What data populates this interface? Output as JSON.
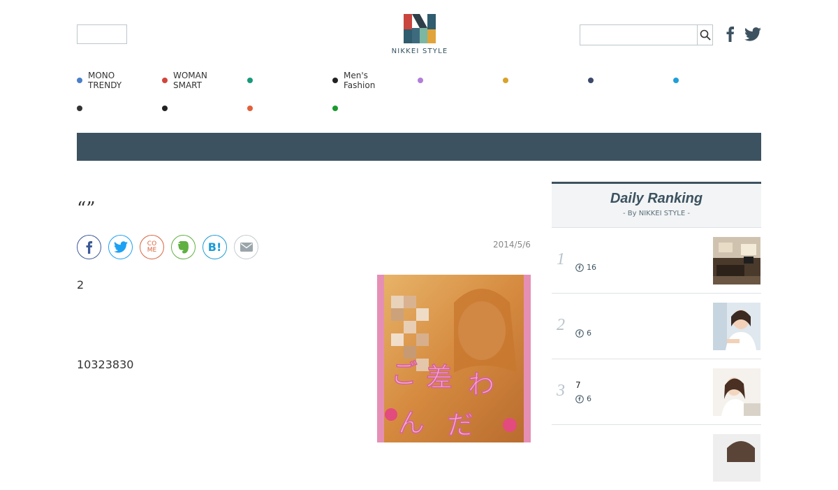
{
  "header": {
    "logo_text": "NIKKEI STYLE",
    "search_placeholder": ""
  },
  "nav": {
    "row1": [
      {
        "label": "MONO\nTRENDY",
        "color": "#4a7fc9"
      },
      {
        "label": "WOMAN\nSMART",
        "color": "#d2453c"
      },
      {
        "label": "",
        "color": "#1a9a7a"
      },
      {
        "label": "Men's\nFashion",
        "color": "#222222"
      },
      {
        "label": "",
        "color": "#b17ed9"
      },
      {
        "label": "",
        "color": "#d8a32a"
      },
      {
        "label": "",
        "color": "#3b4a6b"
      },
      {
        "label": "",
        "color": "#1f9fd9"
      }
    ],
    "row2": [
      {
        "label": "",
        "color": "#333333"
      },
      {
        "label": "",
        "color": "#222222"
      },
      {
        "label": "",
        "color": "#e2603a"
      },
      {
        "label": "",
        "color": "#1a9a2e"
      }
    ]
  },
  "article": {
    "title": "“”",
    "date": "2014/5/6",
    "para1": "2",
    "para2": "10323830",
    "share_come_label": "CO\nME",
    "share_hatena_label": "B!"
  },
  "ranking": {
    "title": "Daily Ranking",
    "subtitle": "- By NIKKEI STYLE -",
    "items": [
      {
        "rank": "1",
        "text": "",
        "count": "16"
      },
      {
        "rank": "2",
        "text": "",
        "count": "6"
      },
      {
        "rank": "3",
        "text": "7",
        "count": "6"
      }
    ]
  },
  "colors": {
    "accent_bar": "#3c5260",
    "facebook": "#3b5998",
    "twitter": "#1da1f2",
    "come": "#d9653f",
    "evernote": "#5fb041",
    "hatena": "#1c9bd5",
    "mail": "#9aa5ab"
  }
}
